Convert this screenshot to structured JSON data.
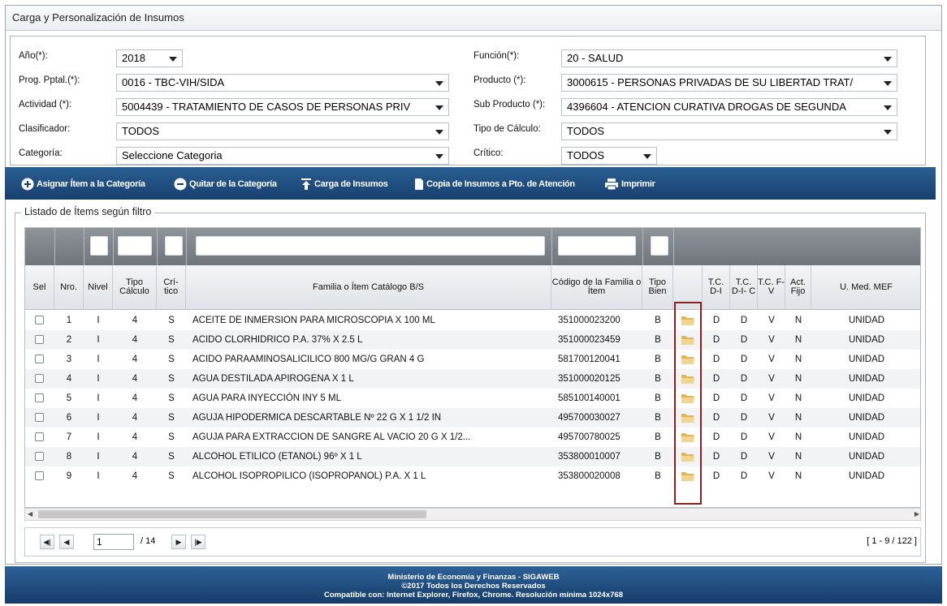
{
  "window": {
    "title": "Carga y Personalización de Insumos"
  },
  "filters": {
    "anio": {
      "label": "Año(*):",
      "value": "2018"
    },
    "prog": {
      "label": "Prog. Pptal.(*):",
      "value": "0016 - TBC-VIH/SIDA"
    },
    "actividad": {
      "label": "Actividad (*):",
      "value": "5004439 - TRATAMIENTO DE CASOS DE PERSONAS PRIV"
    },
    "clasificador": {
      "label": "Clasificador:",
      "value": "TODOS"
    },
    "categoria": {
      "label": "Categoría:",
      "value": "Seleccione Categoria"
    },
    "funcion": {
      "label": "Función(*):",
      "value": "20 - SALUD"
    },
    "producto": {
      "label": "Producto (*):",
      "value": "3000615 - PERSONAS PRIVADAS DE SU LIBERTAD TRAT/"
    },
    "subproducto": {
      "label": "Sub Producto (*):",
      "value": "4396604 - ATENCION CURATIVA DROGAS DE SEGUNDA"
    },
    "tipocalculo": {
      "label": "Tipo de Cálculo:",
      "value": "TODOS"
    },
    "critico": {
      "label": "Crítico:",
      "value": "TODOS"
    }
  },
  "toolbar": {
    "asignar": "Asignar Ítem a la Categoría",
    "quitar": "Quitar de la Categoría",
    "carga": "Carga de Insumos",
    "copia": "Copia de Insumos a Pto. de Atención",
    "imprimir": "Imprimir"
  },
  "list": {
    "legend": "Listado de Ítems según filtro",
    "headers": {
      "sel": "Sel",
      "nro": "Nro.",
      "nivel": "Nivel",
      "tipo_calculo": "Tipo Cálculo",
      "critico": "Crí- tico",
      "familia": "Familia o Ítem Catálogo B/S",
      "codigo": "Código de la Familia o Ítem",
      "tipo_bien": "Tipo Bien",
      "tcdi": "T.C. D-I",
      "tcdic": "T.C. D-I- C",
      "tcfv": "T.C. F-V",
      "actfijo": "Act. Fijo",
      "umed": "U. Med. MEF"
    },
    "rows": [
      {
        "nro": "1",
        "nivel": "I",
        "tipo": "4",
        "critico": "S",
        "familia": "ACEITE DE INMERSION PARA MICROSCOPIA X 100 ML",
        "codigo": "351000023200",
        "bien": "B",
        "tcdi": "D",
        "tcdic": "D",
        "tcfv": "V",
        "fijo": "N",
        "umed": "UNIDAD"
      },
      {
        "nro": "2",
        "nivel": "I",
        "tipo": "4",
        "critico": "S",
        "familia": "ACIDO CLORHIDRICO P.A. 37% X 2.5 L",
        "codigo": "351000023459",
        "bien": "B",
        "tcdi": "D",
        "tcdic": "D",
        "tcfv": "V",
        "fijo": "N",
        "umed": "UNIDAD"
      },
      {
        "nro": "3",
        "nivel": "I",
        "tipo": "4",
        "critico": "S",
        "familia": "ACIDO PARAAMINOSALICILICO 800 MG/G GRAN 4 G",
        "codigo": "581700120041",
        "bien": "B",
        "tcdi": "D",
        "tcdic": "D",
        "tcfv": "V",
        "fijo": "N",
        "umed": "UNIDAD"
      },
      {
        "nro": "4",
        "nivel": "I",
        "tipo": "4",
        "critico": "S",
        "familia": "AGUA DESTILADA APIROGENA X 1 L",
        "codigo": "351000020125",
        "bien": "B",
        "tcdi": "D",
        "tcdic": "D",
        "tcfv": "V",
        "fijo": "N",
        "umed": "UNIDAD"
      },
      {
        "nro": "5",
        "nivel": "I",
        "tipo": "4",
        "critico": "S",
        "familia": "AGUA PARA INYECCIÓN INY 5 ML",
        "codigo": "585100140001",
        "bien": "B",
        "tcdi": "D",
        "tcdic": "D",
        "tcfv": "V",
        "fijo": "N",
        "umed": "UNIDAD"
      },
      {
        "nro": "6",
        "nivel": "I",
        "tipo": "4",
        "critico": "S",
        "familia": "AGUJA HIPODERMICA DESCARTABLE Nº 22 G X 1 1/2 IN",
        "codigo": "495700030027",
        "bien": "B",
        "tcdi": "D",
        "tcdic": "D",
        "tcfv": "V",
        "fijo": "N",
        "umed": "UNIDAD"
      },
      {
        "nro": "7",
        "nivel": "I",
        "tipo": "4",
        "critico": "S",
        "familia": "AGUJA PARA EXTRACCION DE SANGRE AL VACIO 20 G X 1/2...",
        "codigo": "495700780025",
        "bien": "B",
        "tcdi": "D",
        "tcdic": "D",
        "tcfv": "V",
        "fijo": "N",
        "umed": "UNIDAD"
      },
      {
        "nro": "8",
        "nivel": "I",
        "tipo": "4",
        "critico": "S",
        "familia": "ALCOHOL ETILICO (ETANOL) 96º X 1 L",
        "codigo": "353800010007",
        "bien": "B",
        "tcdi": "D",
        "tcdic": "D",
        "tcfv": "V",
        "fijo": "N",
        "umed": "UNIDAD"
      },
      {
        "nro": "9",
        "nivel": "I",
        "tipo": "4",
        "critico": "S",
        "familia": "ALCOHOL ISOPROPILICO (ISOPROPANOL) P.A. X 1 L",
        "codigo": "353800020008",
        "bien": "B",
        "tcdi": "D",
        "tcdic": "D",
        "tcfv": "V",
        "fijo": "N",
        "umed": "UNIDAD"
      }
    ]
  },
  "pager": {
    "page": "1",
    "total": "/ 14",
    "range": "[ 1 - 9 / 122 ]"
  },
  "footer": {
    "line1": "Ministerio de Economía y Finanzas - SIGAWEB",
    "line2": "©2017 Todos los Derechos Reservados",
    "line3": "Compatible con: Internet Explorer, Firefox, Chrome. Resolución mínima 1024x768"
  }
}
